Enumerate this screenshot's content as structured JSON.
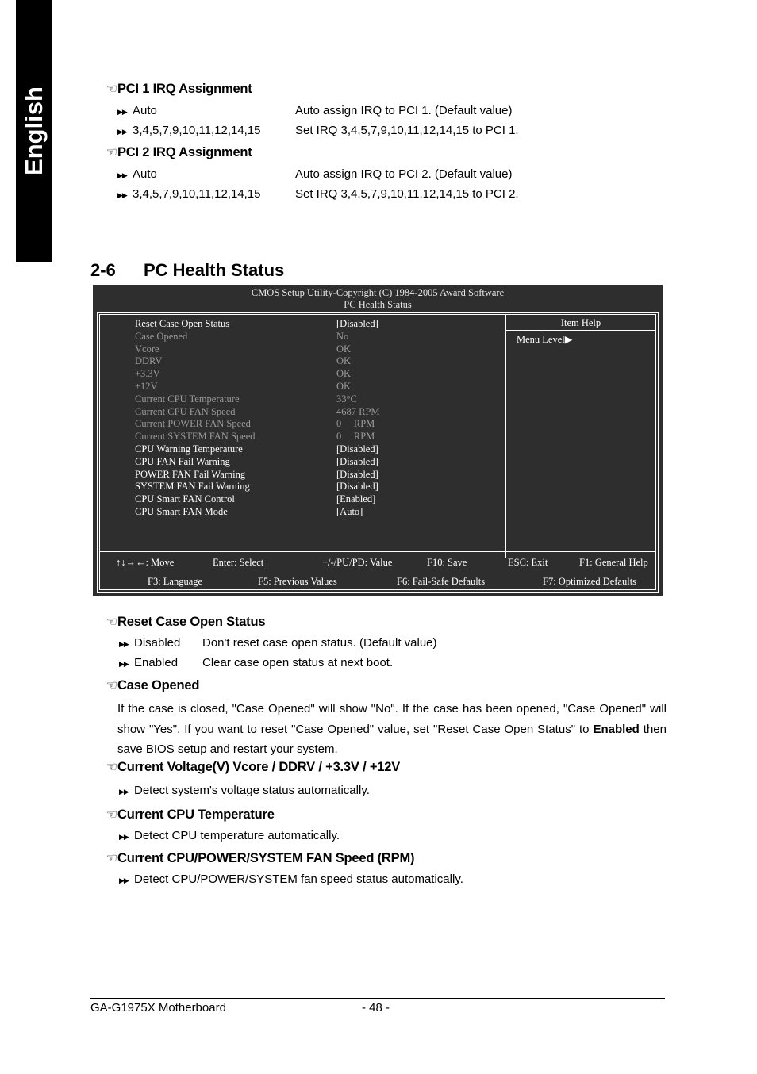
{
  "language_tab": {
    "label": "English"
  },
  "top_sections": [
    {
      "hand_icon": "pointing-hand-icon",
      "title": "PCI 1 IRQ Assignment",
      "options": [
        {
          "name": "Auto",
          "desc": "Auto assign IRQ to PCI 1. (Default value)"
        },
        {
          "name": "3,4,5,7,9,10,11,12,14,15",
          "desc": "Set IRQ 3,4,5,7,9,10,11,12,14,15 to PCI 1."
        }
      ]
    },
    {
      "hand_icon": "pointing-hand-icon",
      "title": "PCI 2 IRQ Assignment",
      "options": [
        {
          "name": "Auto",
          "desc": "Auto assign IRQ to PCI 2. (Default value)"
        },
        {
          "name": "3,4,5,7,9,10,11,12,14,15",
          "desc": "Set IRQ 3,4,5,7,9,10,11,12,14,15 to PCI 2."
        }
      ]
    }
  ],
  "section": {
    "number": "2-6",
    "title": "PC Health Status"
  },
  "bios": {
    "title_line1": "CMOS Setup Utility-Copyright (C) 1984-2005 Award Software",
    "title_line2": "PC Health Status",
    "item_help_title": "Item Help",
    "menu_level": "Menu Level",
    "menu_level_arrow": "▶",
    "rows": [
      {
        "label": "Reset Case Open Status",
        "value": "[Disabled]",
        "state": "active"
      },
      {
        "label": "Case Opened",
        "value": "No",
        "state": "dim"
      },
      {
        "label": "Vcore",
        "value": "OK",
        "state": "dim"
      },
      {
        "label": "DDRV",
        "value": "OK",
        "state": "dim"
      },
      {
        "label": "+3.3V",
        "value": "OK",
        "state": "dim"
      },
      {
        "label": "+12V",
        "value": "OK",
        "state": "dim"
      },
      {
        "label": "Current CPU Temperature",
        "value": "33°C",
        "state": "dim"
      },
      {
        "label": "Current CPU FAN Speed",
        "value": "4687 RPM",
        "state": "dim"
      },
      {
        "label": "Current POWER FAN Speed",
        "value": "0     RPM",
        "state": "dim"
      },
      {
        "label": "Current SYSTEM FAN Speed",
        "value": "0     RPM",
        "state": "dim"
      },
      {
        "label": "CPU Warning Temperature",
        "value": "[Disabled]",
        "state": "active"
      },
      {
        "label": "CPU FAN Fail Warning",
        "value": "[Disabled]",
        "state": "active"
      },
      {
        "label": "POWER FAN Fail Warning",
        "value": "[Disabled]",
        "state": "active"
      },
      {
        "label": "SYSTEM FAN Fail Warning",
        "value": "[Disabled]",
        "state": "active"
      },
      {
        "label": "CPU Smart FAN Control",
        "value": "[Enabled]",
        "state": "active"
      },
      {
        "label": "CPU Smart FAN Mode",
        "value": "[Auto]",
        "state": "active"
      }
    ],
    "footer_line1": [
      "↑↓→←: Move",
      "Enter: Select",
      "+/-/PU/PD: Value",
      "F10: Save",
      "ESC: Exit",
      "F1: General Help"
    ],
    "footer_line2": [
      "F3: Language",
      "F5: Previous Values",
      "F6: Fail-Safe Defaults",
      "F7: Optimized Defaults"
    ]
  },
  "bottom_sections": [
    {
      "title": "Reset Case Open Status",
      "options": [
        {
          "name": "Disabled",
          "desc": "Don't reset case open status. (Default value)"
        },
        {
          "name": "Enabled",
          "desc": "Clear case open status at next boot."
        }
      ]
    },
    {
      "title": "Case Opened",
      "paragraph_part1": "If the case is closed, \"Case Opened\" will show \"No\". If the case has been opened, \"Case Opened\" will show \"Yes\". If you want to reset \"Case Opened\" value, set \"Reset Case Open Status\" to ",
      "paragraph_bold": "Enabled",
      "paragraph_part2": " then save BIOS setup and restart your system."
    },
    {
      "title": "Current Voltage(V) Vcore / DDRV  / +3.3V / +12V",
      "options": [
        {
          "name": "",
          "desc": "Detect system's voltage status automatically."
        }
      ]
    },
    {
      "title": "Current CPU Temperature",
      "options": [
        {
          "name": "",
          "desc": "Detect CPU temperature automatically."
        }
      ]
    },
    {
      "title": "Current CPU/POWER/SYSTEM FAN Speed (RPM)",
      "options": [
        {
          "name": "",
          "desc": "Detect CPU/POWER/SYSTEM fan speed status automatically."
        }
      ]
    }
  ],
  "footer": {
    "product": "GA-G1975X Motherboard",
    "page": "- 48 -"
  },
  "glyphs": {
    "hand": "☞",
    "double_arrow": "▶▶"
  }
}
